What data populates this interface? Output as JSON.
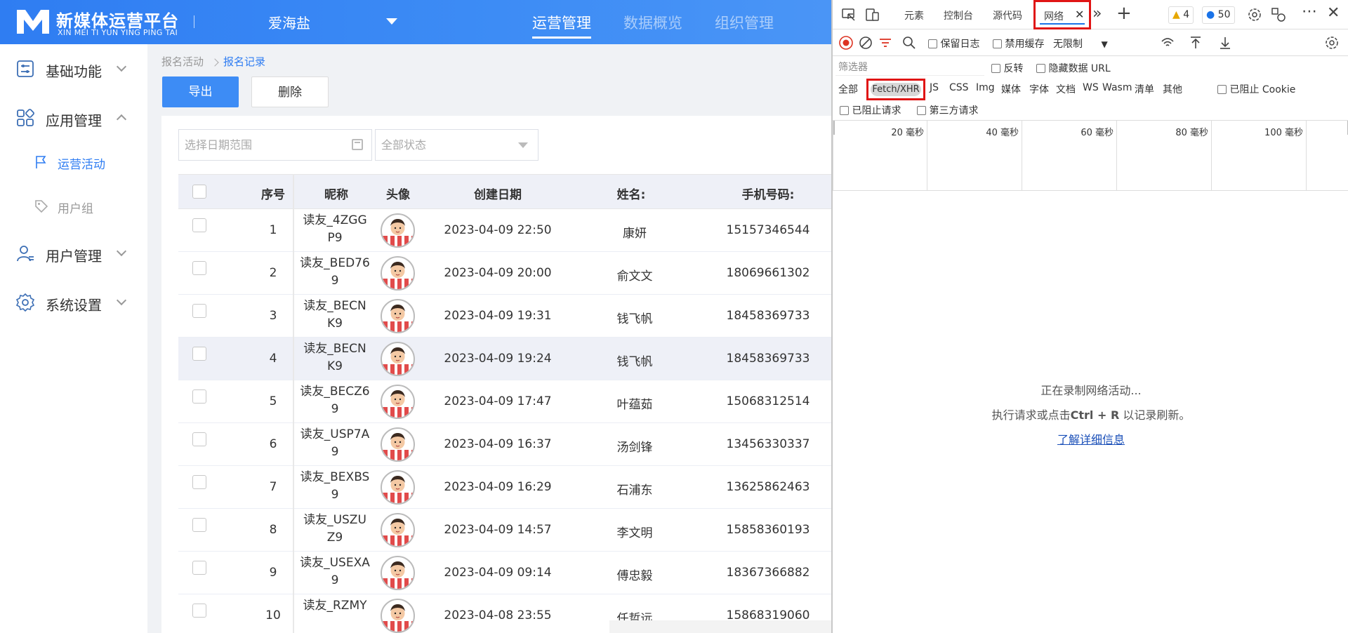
{
  "app": {
    "logo_cn": "新媒体运营平台",
    "logo_en": "XIN MEI TI YUN YING PING TAI",
    "org": "爱海盐",
    "top_nav": [
      {
        "label": "运营管理",
        "active": true
      },
      {
        "label": "数据概览",
        "active": false
      },
      {
        "label": "组织管理",
        "active": false
      }
    ]
  },
  "sidebar": {
    "items": [
      {
        "label": "基础功能",
        "icon": "sliders-icon",
        "expanded": false
      },
      {
        "label": "应用管理",
        "icon": "apps-icon",
        "expanded": true
      },
      {
        "label": "用户管理",
        "icon": "user-icon",
        "expanded": false
      },
      {
        "label": "系统设置",
        "icon": "gear-icon",
        "expanded": false
      }
    ],
    "subitems": [
      {
        "label": "运营活动",
        "icon": "flag-icon",
        "active": true
      },
      {
        "label": "用户组",
        "icon": "tag-icon",
        "active": false
      }
    ]
  },
  "breadcrumb": {
    "parent": "报名活动",
    "current": "报名记录"
  },
  "toolbar": {
    "export": "导出",
    "delete": "删除"
  },
  "filters": {
    "date_placeholder": "选择日期范围",
    "status_placeholder": "全部状态"
  },
  "table": {
    "columns": [
      "序号",
      "昵称",
      "头像",
      "创建日期",
      "姓名:",
      "手机号码:"
    ],
    "rows": [
      {
        "no": "1",
        "nick": "读友_4ZGGP9",
        "date": "2023-04-09 22:50",
        "name": "康妍",
        "phone": "15157346544"
      },
      {
        "no": "2",
        "nick": "读友_BED769",
        "date": "2023-04-09 20:00",
        "name": "俞文文",
        "phone": "18069661302"
      },
      {
        "no": "3",
        "nick": "读友_BECNK9",
        "date": "2023-04-09 19:31",
        "name": "钱飞帆",
        "phone": "18458369733"
      },
      {
        "no": "4",
        "nick": "读友_BECNK9",
        "date": "2023-04-09 19:24",
        "name": "钱飞帆",
        "phone": "18458369733"
      },
      {
        "no": "5",
        "nick": "读友_BECZ69",
        "date": "2023-04-09 17:47",
        "name": "叶蕴茹",
        "phone": "15068312514"
      },
      {
        "no": "6",
        "nick": "读友_USP7A9",
        "date": "2023-04-09 16:37",
        "name": "汤剑锋",
        "phone": "13456330337"
      },
      {
        "no": "7",
        "nick": "读友_BEXBS9",
        "date": "2023-04-09 16:29",
        "name": "石浦东",
        "phone": "13625862463"
      },
      {
        "no": "8",
        "nick": "读友_USZUZ9",
        "date": "2023-04-09 14:57",
        "name": "李文明",
        "phone": "15858360193"
      },
      {
        "no": "9",
        "nick": "读友_USEXA9",
        "date": "2023-04-09 09:14",
        "name": "傅忠毅",
        "phone": "18367366882"
      },
      {
        "no": "10",
        "nick": "读友_RZMY",
        "date": "2023-04-08 23:55",
        "name": "任哲远",
        "phone": "15868319060"
      }
    ]
  },
  "devtools": {
    "tabs": [
      "元素",
      "控制台",
      "源代码",
      "网络"
    ],
    "active_tab": "网络",
    "warnings": "4",
    "messages": "50",
    "preserve_log": "保留日志",
    "disable_cache": "禁用缓存",
    "throttling": "无限制",
    "filter_placeholder": "筛选器",
    "invert": "反转",
    "hide_data_url": "隐藏数据 URL",
    "types": [
      "全部",
      "Fetch/XHR",
      "JS",
      "CSS",
      "Img",
      "媒体",
      "字体",
      "文档",
      "WS",
      "Wasm",
      "清单",
      "其他"
    ],
    "blocked_cookies": "已阻止 Cookie",
    "blocked_requests": "已阻止请求",
    "third_party": "第三方请求",
    "timeline_ticks": [
      "20 毫秒",
      "40 毫秒",
      "60 毫秒",
      "80 毫秒",
      "100 毫秒"
    ],
    "empty_line1": "正在录制网络活动...",
    "empty_line2_pre": "执行请求或点击",
    "empty_line2_key": "Ctrl + R",
    "empty_line2_post": "以记录刷新。",
    "learn_more": "了解详细信息"
  }
}
